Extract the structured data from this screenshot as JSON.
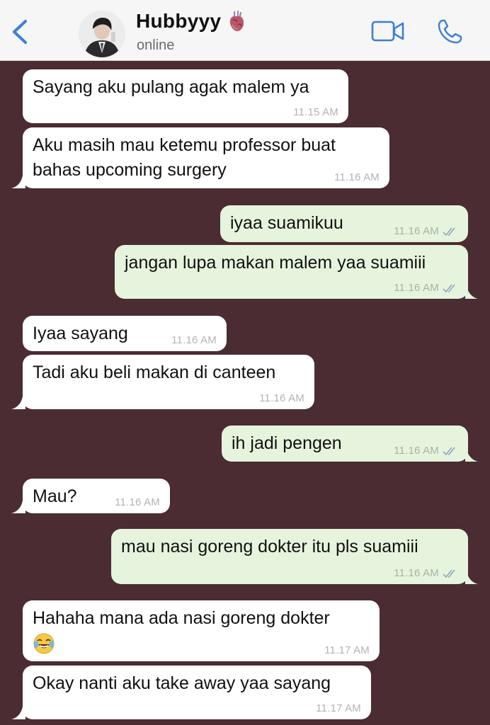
{
  "header": {
    "back_icon": "chevron-left-icon",
    "contact_name": "Hubbyyy",
    "contact_emoji": "anatomical-heart",
    "status": "online",
    "video_icon": "video-camera-icon",
    "phone_icon": "phone-icon"
  },
  "colors": {
    "chat_background": "#4a2c32",
    "incoming_bubble": "#ffffff",
    "outgoing_bubble": "#e6f4dd",
    "accent": "#3d7fd6"
  },
  "messages": [
    {
      "direction": "in",
      "text": "Sayang aku pulang agak malem ya",
      "time": "11.15 AM"
    },
    {
      "direction": "in",
      "text": "Aku masih mau ketemu professor buat bahas upcoming surgery",
      "time": "11.16 AM"
    },
    {
      "direction": "out",
      "text": "iyaa suamikuu",
      "time": "11.16 AM",
      "read": true
    },
    {
      "direction": "out",
      "text": "jangan lupa makan malem yaa suamiii",
      "time": "11.16 AM",
      "read": true
    },
    {
      "direction": "in",
      "text": "Iyaa sayang",
      "time": "11.16 AM"
    },
    {
      "direction": "in",
      "text": "Tadi aku beli makan di canteen",
      "time": "11.16 AM"
    },
    {
      "direction": "out",
      "text": "ih jadi pengen",
      "time": "11.16 AM",
      "read": true
    },
    {
      "direction": "in",
      "text": "Mau?",
      "time": "11.16 AM"
    },
    {
      "direction": "out",
      "text": "mau nasi goreng dokter itu pls suamiii",
      "time": "11.16 AM",
      "read": true
    },
    {
      "direction": "in",
      "text": "Hahaha mana ada nasi goreng dokter",
      "emoji": "face-with-tears-of-joy",
      "time": "11.17 AM"
    },
    {
      "direction": "in",
      "text": "Okay nanti aku take away yaa sayang",
      "time": "11.17 AM"
    }
  ]
}
